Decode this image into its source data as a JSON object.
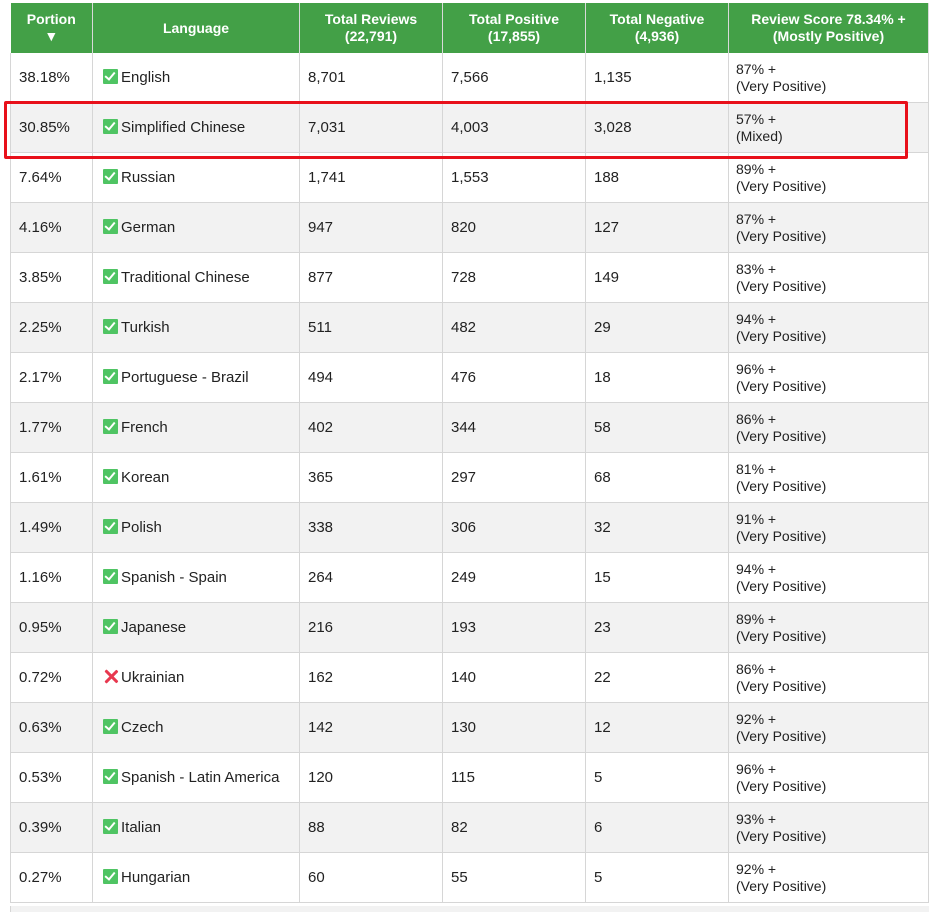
{
  "header": {
    "portion": "Portion",
    "portion_sort": "▼",
    "language": "Language",
    "total_reviews": "Total Reviews",
    "total_reviews_count": "(22,791)",
    "total_positive": "Total Positive",
    "total_positive_count": "(17,855)",
    "total_negative": "Total Negative",
    "total_negative_count": "(4,936)",
    "review_score": "Review Score 78.34% +",
    "review_score_label": "(Mostly Positive)"
  },
  "colors": {
    "header_bg": "#43a047",
    "check": "#4fc463",
    "cross": "#e8384f",
    "highlight": "#e8101a"
  },
  "rows": [
    {
      "portion": "38.18%",
      "language": "English",
      "supported": true,
      "reviews": "8,701",
      "positive": "7,566",
      "negative": "1,135",
      "score": "87% +",
      "rating": "(Very Positive)"
    },
    {
      "portion": "30.85%",
      "language": "Simplified Chinese",
      "supported": true,
      "reviews": "7,031",
      "positive": "4,003",
      "negative": "3,028",
      "score": "57% +",
      "rating": "(Mixed)"
    },
    {
      "portion": "7.64%",
      "language": "Russian",
      "supported": true,
      "reviews": "1,741",
      "positive": "1,553",
      "negative": "188",
      "score": "89% +",
      "rating": "(Very Positive)"
    },
    {
      "portion": "4.16%",
      "language": "German",
      "supported": true,
      "reviews": "947",
      "positive": "820",
      "negative": "127",
      "score": "87% +",
      "rating": "(Very Positive)"
    },
    {
      "portion": "3.85%",
      "language": "Traditional Chinese",
      "supported": true,
      "reviews": "877",
      "positive": "728",
      "negative": "149",
      "score": "83% +",
      "rating": "(Very Positive)"
    },
    {
      "portion": "2.25%",
      "language": "Turkish",
      "supported": true,
      "reviews": "511",
      "positive": "482",
      "negative": "29",
      "score": "94% +",
      "rating": "(Very Positive)"
    },
    {
      "portion": "2.17%",
      "language": "Portuguese - Brazil",
      "supported": true,
      "reviews": "494",
      "positive": "476",
      "negative": "18",
      "score": "96% +",
      "rating": "(Very Positive)"
    },
    {
      "portion": "1.77%",
      "language": "French",
      "supported": true,
      "reviews": "402",
      "positive": "344",
      "negative": "58",
      "score": "86% +",
      "rating": "(Very Positive)"
    },
    {
      "portion": "1.61%",
      "language": "Korean",
      "supported": true,
      "reviews": "365",
      "positive": "297",
      "negative": "68",
      "score": "81% +",
      "rating": "(Very Positive)"
    },
    {
      "portion": "1.49%",
      "language": "Polish",
      "supported": true,
      "reviews": "338",
      "positive": "306",
      "negative": "32",
      "score": "91% +",
      "rating": "(Very Positive)"
    },
    {
      "portion": "1.16%",
      "language": "Spanish - Spain",
      "supported": true,
      "reviews": "264",
      "positive": "249",
      "negative": "15",
      "score": "94% +",
      "rating": "(Very Positive)"
    },
    {
      "portion": "0.95%",
      "language": "Japanese",
      "supported": true,
      "reviews": "216",
      "positive": "193",
      "negative": "23",
      "score": "89% +",
      "rating": "(Very Positive)"
    },
    {
      "portion": "0.72%",
      "language": "Ukrainian",
      "supported": false,
      "reviews": "162",
      "positive": "140",
      "negative": "22",
      "score": "86% +",
      "rating": "(Very Positive)"
    },
    {
      "portion": "0.63%",
      "language": "Czech",
      "supported": true,
      "reviews": "142",
      "positive": "130",
      "negative": "12",
      "score": "92% +",
      "rating": "(Very Positive)"
    },
    {
      "portion": "0.53%",
      "language": "Spanish - Latin America",
      "supported": true,
      "reviews": "120",
      "positive": "115",
      "negative": "5",
      "score": "96% +",
      "rating": "(Very Positive)"
    },
    {
      "portion": "0.39%",
      "language": "Italian",
      "supported": true,
      "reviews": "88",
      "positive": "82",
      "negative": "6",
      "score": "93% +",
      "rating": "(Very Positive)"
    },
    {
      "portion": "0.27%",
      "language": "Hungarian",
      "supported": true,
      "reviews": "60",
      "positive": "55",
      "negative": "5",
      "score": "92% +",
      "rating": "(Very Positive)"
    }
  ],
  "highlighted_row": "Simplified Chinese"
}
